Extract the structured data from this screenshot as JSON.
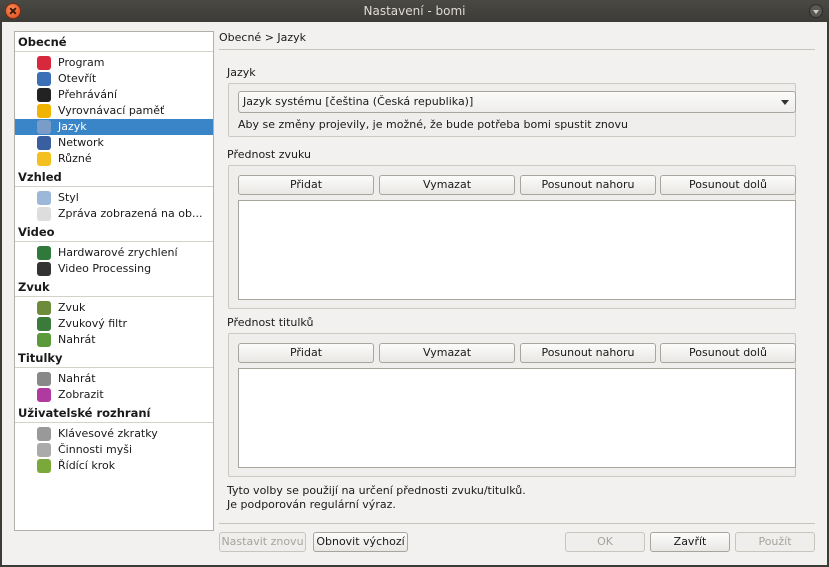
{
  "window": {
    "title": "Nastavení - bomi"
  },
  "sidebar": {
    "groups": [
      {
        "title": "Obecné",
        "items": [
          {
            "label": "Program",
            "icon": "program-icon",
            "color": "#d8283c"
          },
          {
            "label": "Otevřít",
            "icon": "open-icon",
            "color": "#3b6fb6"
          },
          {
            "label": "Přehrávání",
            "icon": "play-icon",
            "color": "#222222"
          },
          {
            "label": "Vyrovnávací paměť",
            "icon": "cache-icon",
            "color": "#f0b400"
          },
          {
            "label": "Jazyk",
            "icon": "language-icon",
            "color": "#7a9cc8",
            "selected": true
          },
          {
            "label": "Network",
            "icon": "network-icon",
            "color": "#3a5fa0"
          },
          {
            "label": "Různé",
            "icon": "misc-icon",
            "color": "#f3c020"
          }
        ]
      },
      {
        "title": "Vzhled",
        "items": [
          {
            "label": "Styl",
            "icon": "style-icon",
            "color": "#9cb8d8"
          },
          {
            "label": "Zpráva zobrazená na ob...",
            "icon": "osd-icon",
            "color": "#dddddd"
          }
        ]
      },
      {
        "title": "Video",
        "items": [
          {
            "label": "Hardwarové zrychlení",
            "icon": "hardware-icon",
            "color": "#2f7a3a"
          },
          {
            "label": "Video Processing",
            "icon": "video-icon",
            "color": "#333333"
          }
        ]
      },
      {
        "title": "Zvuk",
        "items": [
          {
            "label": "Zvuk",
            "icon": "audio-icon",
            "color": "#6c8c3c"
          },
          {
            "label": "Zvukový filtr",
            "icon": "audio-filter-icon",
            "color": "#3a7a3a"
          },
          {
            "label": "Nahrát",
            "icon": "audio-load-icon",
            "color": "#5a9a3a"
          }
        ]
      },
      {
        "title": "Titulky",
        "items": [
          {
            "label": "Nahrát",
            "icon": "subtitle-load-icon",
            "color": "#888888"
          },
          {
            "label": "Zobrazit",
            "icon": "subtitle-display-icon",
            "color": "#b03aa0"
          }
        ]
      },
      {
        "title": "Uživatelské rozhraní",
        "items": [
          {
            "label": "Klávesové zkratky",
            "icon": "keyboard-icon",
            "color": "#999999"
          },
          {
            "label": "Činnosti myši",
            "icon": "mouse-icon",
            "color": "#aaaaaa"
          },
          {
            "label": "Řídící krok",
            "icon": "control-step-icon",
            "color": "#7aa83a"
          }
        ]
      }
    ]
  },
  "breadcrumb": "Obecné > Jazyk",
  "language": {
    "label": "Jazyk",
    "selected": "Jazyk systému [čeština (Česká republika)]",
    "restart_note": "Aby se změny projevily, je možné, že bude potřeba bomi spustit znovu"
  },
  "audio_priority": {
    "label": "Přednost zvuku",
    "add": "Přidat",
    "remove": "Vymazat",
    "move_up": "Posunout nahoru",
    "move_down": "Posunout dolů"
  },
  "subtitle_priority": {
    "label": "Přednost titulků",
    "add": "Přidat",
    "remove": "Vymazat",
    "move_up": "Posunout nahoru",
    "move_down": "Posunout dolů"
  },
  "footer_note": {
    "line1": "Tyto volby se použijí na určení přednosti zvuku/titulků.",
    "line2": "Je podporován regulární výraz."
  },
  "buttons": {
    "reset": "Nastavit znovu",
    "restore_defaults": "Obnovit výchozí",
    "ok": "OK",
    "close": "Zavřít",
    "apply": "Použít"
  },
  "colors": {
    "selection": "#3a85c8",
    "titlebar": "#3c3b37"
  }
}
